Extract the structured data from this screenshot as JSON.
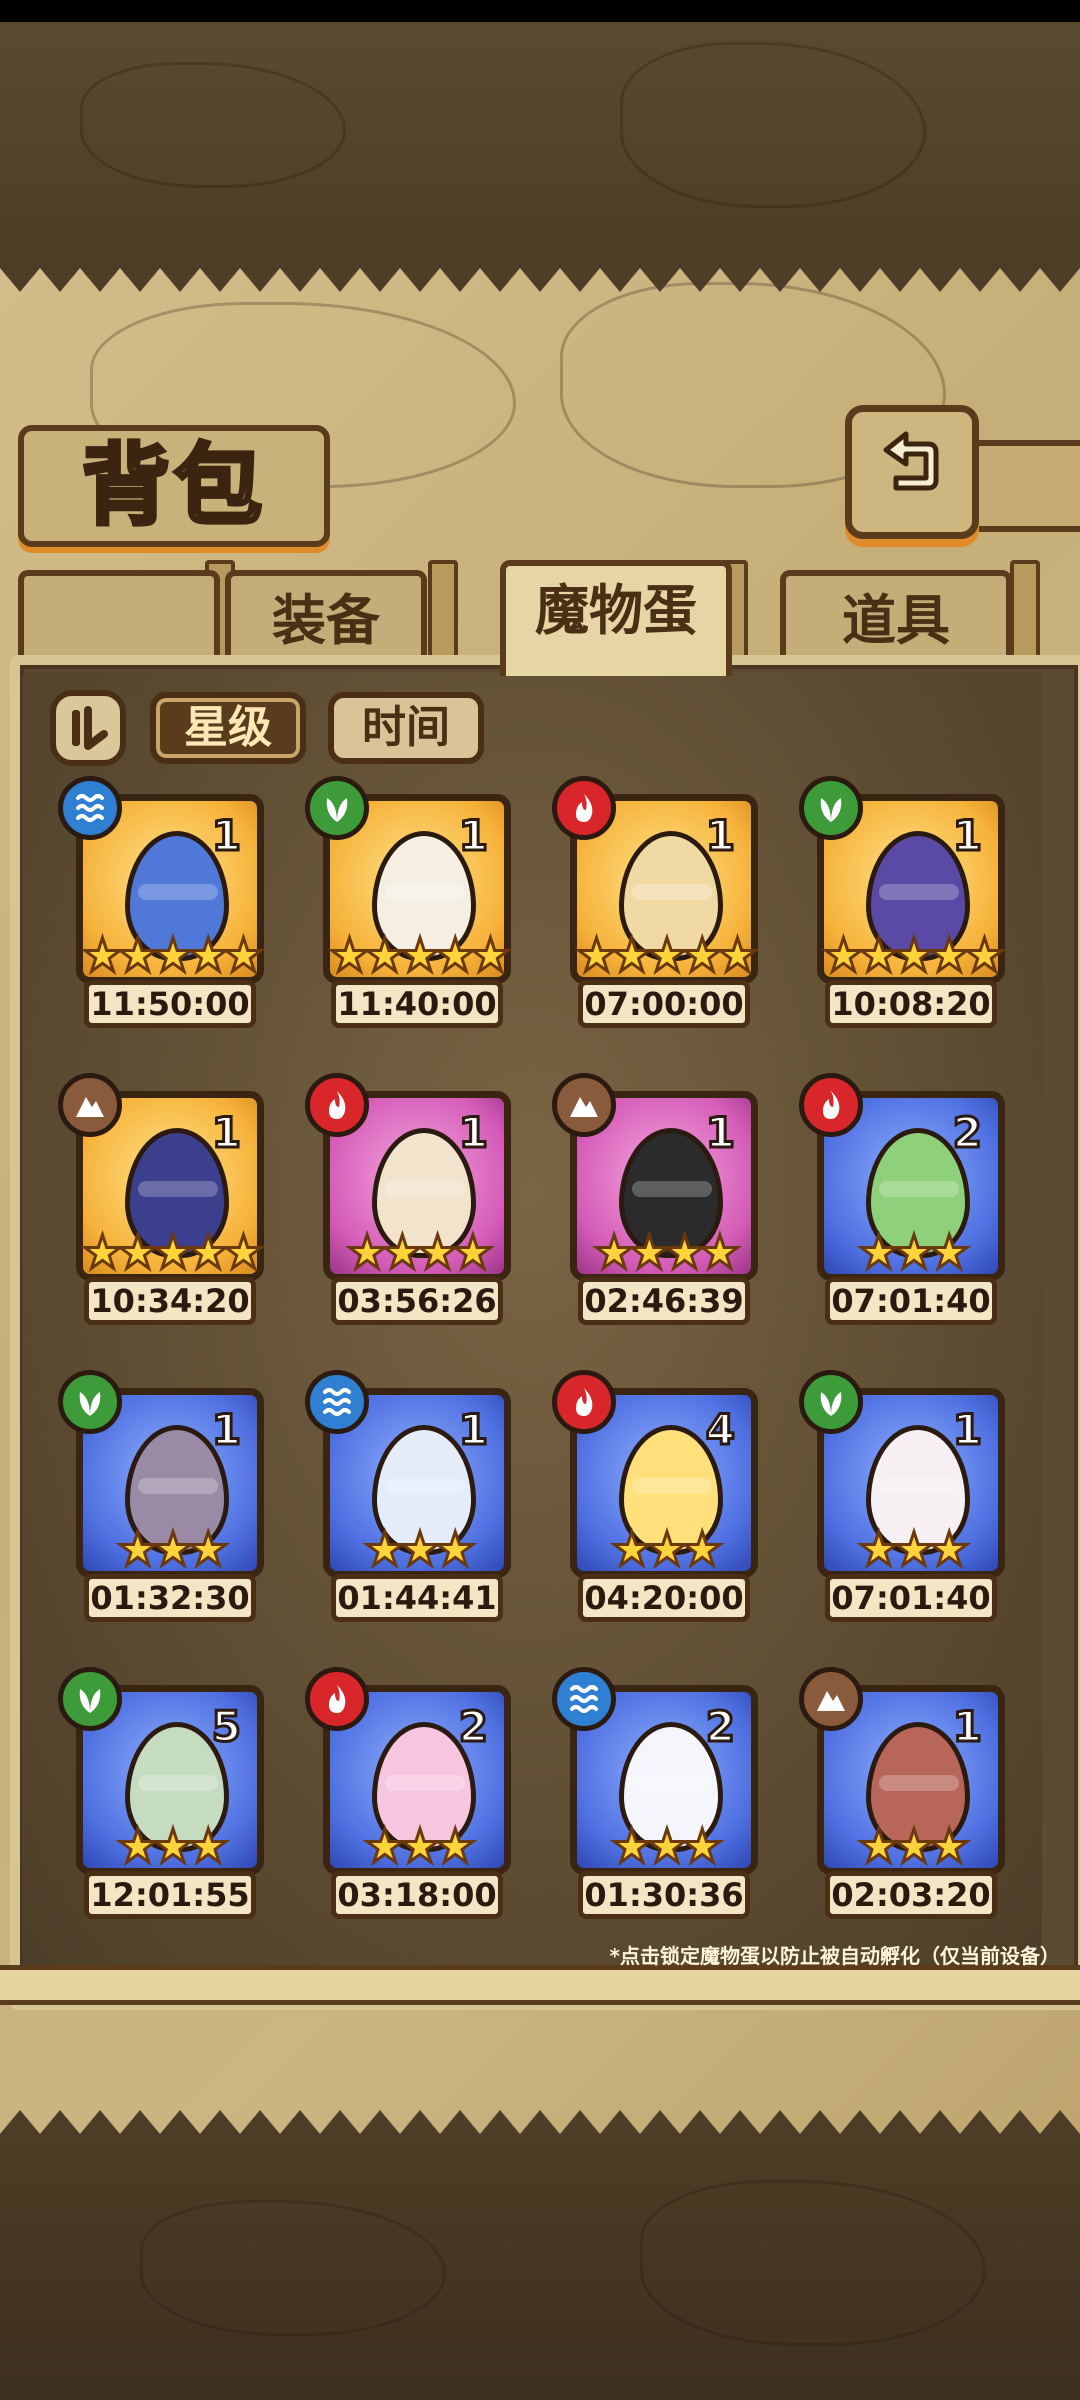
{
  "header": {
    "title": "背包"
  },
  "tabs": [
    {
      "label": "装备",
      "active": false
    },
    {
      "label": "魔物蛋",
      "active": true
    },
    {
      "label": "道具",
      "active": false
    }
  ],
  "sort": {
    "star_label": "星级",
    "time_label": "时间",
    "selected": "星级"
  },
  "eggs": [
    {
      "element": "water",
      "count": "1",
      "stars": "★★★★★",
      "rarity": "gold",
      "timer": "11:50:00",
      "color": "#4f78d8"
    },
    {
      "element": "grass",
      "count": "1",
      "stars": "★★★★★",
      "rarity": "gold",
      "timer": "11:40:00",
      "color": "#f4efe2"
    },
    {
      "element": "fire",
      "count": "1",
      "stars": "★★★★★",
      "rarity": "gold",
      "timer": "07:00:00",
      "color": "#f1d9a4"
    },
    {
      "element": "grass",
      "count": "1",
      "stars": "★★★★★",
      "rarity": "gold",
      "timer": "10:08:20",
      "color": "#5a4aa6"
    },
    {
      "element": "earth",
      "count": "1",
      "stars": "★★★★★",
      "rarity": "gold",
      "timer": "10:34:20",
      "color": "#3c3f8e"
    },
    {
      "element": "fire",
      "count": "1",
      "stars": "★★★★",
      "rarity": "purple",
      "timer": "03:56:26",
      "color": "#f2e4cc"
    },
    {
      "element": "earth",
      "count": "1",
      "stars": "★★★★",
      "rarity": "purple",
      "timer": "02:46:39",
      "color": "#2b2b2b"
    },
    {
      "element": "fire",
      "count": "2",
      "stars": "★★★",
      "rarity": "blue",
      "timer": "07:01:40",
      "color": "#8fd07a"
    },
    {
      "element": "grass",
      "count": "1",
      "stars": "★★★",
      "rarity": "blue",
      "timer": "01:32:30",
      "color": "#9a8aa6"
    },
    {
      "element": "water",
      "count": "1",
      "stars": "★★★",
      "rarity": "blue",
      "timer": "01:44:41",
      "color": "#e4ecfa"
    },
    {
      "element": "fire",
      "count": "4",
      "stars": "★★★",
      "rarity": "blue",
      "timer": "04:20:00",
      "color": "#ffe07a"
    },
    {
      "element": "grass",
      "count": "1",
      "stars": "★★★",
      "rarity": "blue",
      "timer": "07:01:40",
      "color": "#f6f0f4"
    },
    {
      "element": "grass",
      "count": "5",
      "stars": "★★★",
      "rarity": "blue",
      "timer": "12:01:55",
      "color": "#c5dcc0"
    },
    {
      "element": "fire",
      "count": "2",
      "stars": "★★★",
      "rarity": "blue",
      "timer": "03:18:00",
      "color": "#f7c6de"
    },
    {
      "element": "water",
      "count": "2",
      "stars": "★★★",
      "rarity": "blue",
      "timer": "01:30:36",
      "color": "#f4f6fb"
    },
    {
      "element": "earth",
      "count": "1",
      "stars": "★★★",
      "rarity": "blue",
      "timer": "02:03:20",
      "color": "#b8655a"
    }
  ],
  "footer_note": "*点击锁定魔物蛋以防止被自动孵化（仅当前设备）",
  "colors": {
    "accent_orange": "#e08a2a",
    "frame_dark": "#5a3b1c",
    "parchment": "#c6ae78"
  }
}
